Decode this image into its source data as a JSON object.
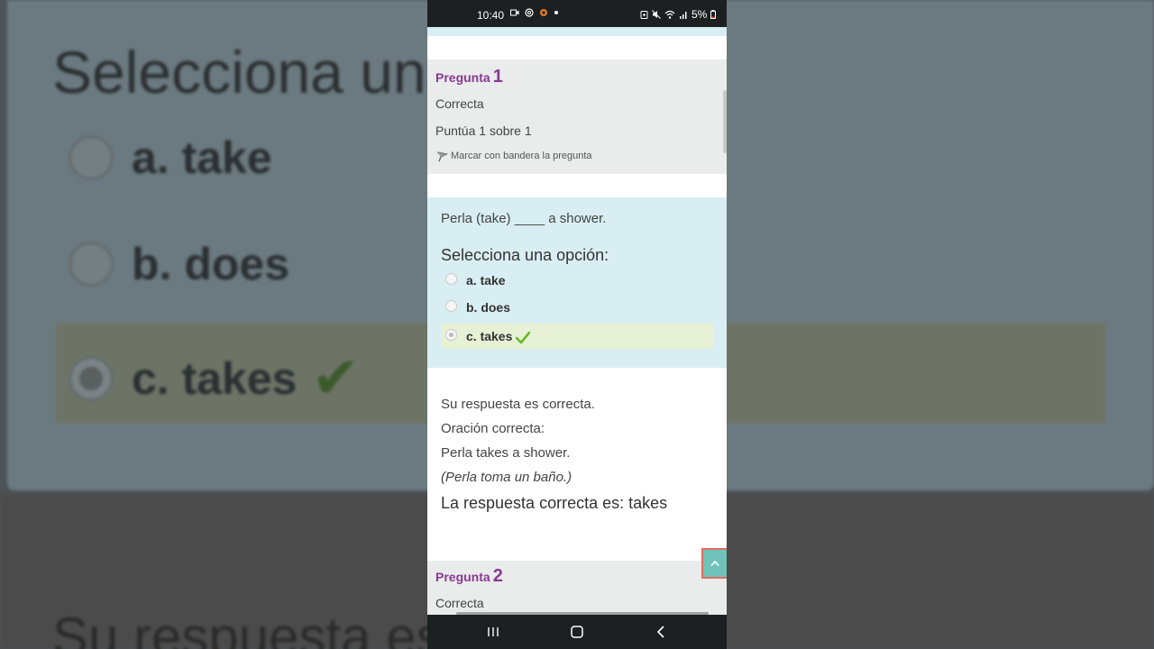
{
  "status_bar": {
    "time": "10:40",
    "battery": "5%",
    "left_icons": [
      "video-icon",
      "at-icon",
      "app-icon",
      "dot-icon"
    ],
    "right_icons": [
      "battery-saver-icon",
      "mute-icon",
      "wifi-icon",
      "signal-icon"
    ]
  },
  "background_zoom": {
    "title": "Selecciona una opción:",
    "options": [
      "a. take",
      "b. does",
      "c. takes"
    ],
    "footer": "Su respuesta es correcta."
  },
  "question1": {
    "label": "Pregunta",
    "number": "1",
    "status": "Correcta",
    "score": "Puntúa 1 sobre 1",
    "flag_text": "Marcar con bandera la pregunta",
    "text": "Perla (take) ____ a shower.",
    "prompt": "Selecciona una opción:",
    "options": [
      {
        "label": "a. take",
        "selected": false,
        "correct": false
      },
      {
        "label": "b. does",
        "selected": false,
        "correct": false
      },
      {
        "label": "c. takes",
        "selected": true,
        "correct": true
      }
    ],
    "feedback": {
      "line1": "Su respuesta es correcta.",
      "line2": "Oración correcta:",
      "line3": "Perla takes a shower.",
      "line4": "(Perla toma un baño.)",
      "answer": "La respuesta correcta es: takes"
    }
  },
  "question2": {
    "label": "Pregunta",
    "number": "2",
    "status": "Correcta"
  },
  "colors": {
    "accent_purple": "#883993",
    "question_bg": "#d9eef2",
    "info_bg": "#e9ecea",
    "correct_bg": "#e6f1d5",
    "check_green": "#6fb52c",
    "to_top_bg": "#6fc3bb"
  }
}
